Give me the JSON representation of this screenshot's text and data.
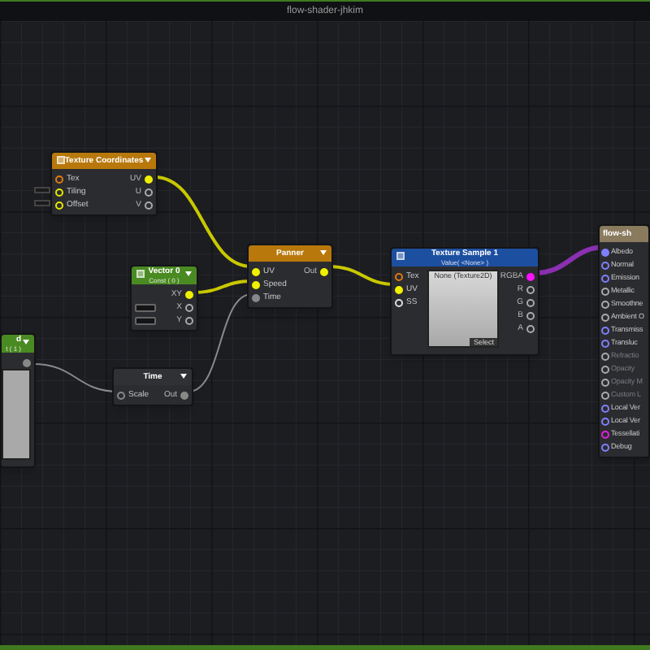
{
  "window": {
    "title": "flow-shader-jhkim"
  },
  "nodes": [
    {
      "title": "Texture Coordinates",
      "color": "#b8780c",
      "header_icon": true,
      "menu_caret": true,
      "inputs": [
        {
          "label": "Tex",
          "kind": "port",
          "color": "#e07a10",
          "connected": false
        },
        {
          "label": "Tiling",
          "kind": "port_with_field",
          "color": "#e8e800",
          "connected": false
        },
        {
          "label": "Offset",
          "kind": "port_with_field",
          "color": "#e8e800",
          "connected": false
        }
      ],
      "outputs": [
        {
          "label": "UV",
          "color": "#f0f000",
          "connected": true
        },
        {
          "label": "U",
          "color": "#aaaaaa",
          "connected": false
        },
        {
          "label": "V",
          "color": "#aaaaaa",
          "connected": false
        }
      ]
    },
    {
      "title": "Vector 0",
      "subtitle": "Const ( 0 )",
      "color": "#4a8a22",
      "header_icon": true,
      "menu_caret": true,
      "inputs": [
        {
          "kind": "blank"
        },
        {
          "kind": "field"
        },
        {
          "kind": "field"
        }
      ],
      "outputs": [
        {
          "label": "XY",
          "color": "#f0f000",
          "connected": true
        },
        {
          "label": "X",
          "color": "#aaaaaa",
          "connected": false
        },
        {
          "label": "Y",
          "color": "#aaaaaa",
          "connected": false
        }
      ]
    },
    {
      "title": "Panner",
      "color": "#b8780c",
      "header_icon": false,
      "menu_caret": true,
      "inputs": [
        {
          "label": "UV",
          "kind": "port",
          "color": "#f0f000",
          "connected": true
        },
        {
          "label": "Speed",
          "kind": "port",
          "color": "#f0f000",
          "connected": true
        },
        {
          "label": "Time",
          "kind": "port",
          "color": "#888888",
          "connected": true
        }
      ],
      "outputs": [
        {
          "label": "Out",
          "color": "#f0f000",
          "connected": true
        }
      ]
    },
    {
      "title": "Texture Sample 1",
      "subtitle": "Value( <None> )",
      "color": "#1c4fa0",
      "header_icon": true,
      "menu_caret": false,
      "inputs": [
        {
          "label": "Tex",
          "kind": "port",
          "color": "#e07a10",
          "connected": false
        },
        {
          "label": "UV",
          "kind": "port",
          "color": "#f0f000",
          "connected": true
        },
        {
          "label": "SS",
          "kind": "port",
          "color": "#dddddd",
          "connected": false
        }
      ],
      "outputs": [
        {
          "label": "RGBA",
          "color": "#ff10ff",
          "connected": true
        },
        {
          "label": "R",
          "color": "#aaaaaa",
          "connected": false
        },
        {
          "label": "G",
          "color": "#aaaaaa",
          "connected": false
        },
        {
          "label": "B",
          "color": "#aaaaaa",
          "connected": false
        },
        {
          "label": "A",
          "color": "#aaaaaa",
          "connected": false
        }
      ],
      "preview": {
        "kind": "texture",
        "caption": "None (Texture2D)",
        "button": "Select"
      }
    },
    {
      "title": "Time",
      "color": "#303134",
      "header_icon": false,
      "menu_caret": true,
      "inputs": [
        {
          "label": "Scale",
          "kind": "port",
          "color": "#888888",
          "connected": false
        }
      ],
      "outputs": [
        {
          "label": "Out",
          "color": "#888888",
          "connected": true
        }
      ]
    },
    {
      "title": "d",
      "subtitle": "t ( 1 )",
      "color": "#4a8a22",
      "header_icon": false,
      "menu_caret": true,
      "outputs": [
        {
          "color": "#888888",
          "connected": true
        }
      ],
      "preview": {
        "kind": "plain"
      }
    },
    {
      "title": "flow-sh",
      "color": "#8a7a5e",
      "header_icon": false,
      "menu_caret": false,
      "inputs": [
        {
          "label": "Albedo",
          "kind": "port",
          "color": "#8080ff",
          "connected": true,
          "disabled": false
        },
        {
          "label": "Normal",
          "kind": "port",
          "color": "#8080ff",
          "connected": false,
          "disabled": false
        },
        {
          "label": "Emission",
          "kind": "port",
          "color": "#8080ff",
          "connected": false,
          "disabled": false
        },
        {
          "label": "Metallic",
          "kind": "port",
          "color": "#aaaaaa",
          "connected": false,
          "disabled": false
        },
        {
          "label": "Smoothne",
          "kind": "port",
          "color": "#aaaaaa",
          "connected": false,
          "disabled": false
        },
        {
          "label": "Ambient O",
          "kind": "port",
          "color": "#aaaaaa",
          "connected": false,
          "disabled": false
        },
        {
          "label": "Transmiss",
          "kind": "port",
          "color": "#8080ff",
          "connected": false,
          "disabled": false
        },
        {
          "label": "Transluc",
          "kind": "port",
          "color": "#8080ff",
          "connected": false,
          "disabled": false
        },
        {
          "label": "Refractio",
          "kind": "port",
          "color": "#aaaaaa",
          "connected": false,
          "disabled": true
        },
        {
          "label": "Opacity",
          "kind": "port",
          "color": "#aaaaaa",
          "connected": false,
          "disabled": true
        },
        {
          "label": "Opacity M",
          "kind": "port",
          "color": "#aaaaaa",
          "connected": false,
          "disabled": true
        },
        {
          "label": "Custom L",
          "kind": "port",
          "color": "#aaaaaa",
          "connected": false,
          "disabled": true
        },
        {
          "label": "Local Ver",
          "kind": "port",
          "color": "#8080ff",
          "connected": false,
          "disabled": false
        },
        {
          "label": "Local Ver",
          "kind": "port",
          "color": "#8080ff",
          "connected": false,
          "disabled": false
        },
        {
          "label": "Tessellati",
          "kind": "port",
          "color": "#e020e0",
          "connected": false,
          "disabled": false
        },
        {
          "label": "Debug",
          "kind": "port",
          "color": "#8080ff",
          "connected": false,
          "disabled": false
        }
      ]
    }
  ]
}
